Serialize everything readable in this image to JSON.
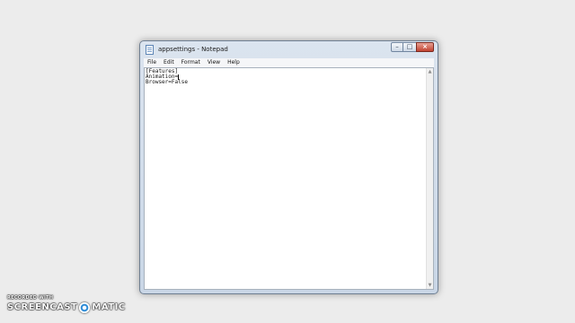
{
  "window": {
    "title": "appsettings - Notepad",
    "buttons": {
      "minimize": "–",
      "maximize": "□",
      "close": "×"
    }
  },
  "menu": {
    "items": [
      "File",
      "Edit",
      "Format",
      "View",
      "Help"
    ]
  },
  "editor": {
    "lines": [
      "[Features]",
      "Animation=",
      "Browser=False"
    ]
  },
  "watermark": {
    "top": "RECORDED WITH",
    "left": "SCREENCAST",
    "right": "MATIC"
  }
}
